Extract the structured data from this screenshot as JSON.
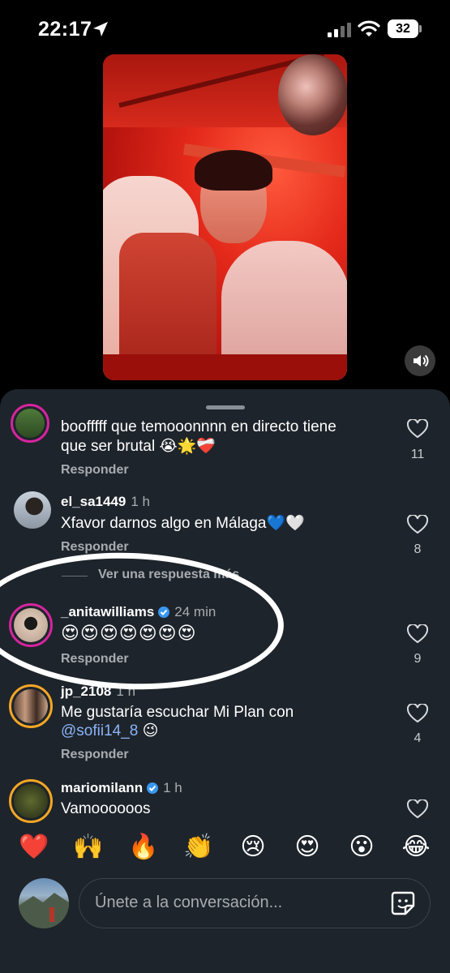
{
  "status_bar": {
    "time": "22:17",
    "battery": "32"
  },
  "comments": [
    {
      "user": "",
      "time": "",
      "text": "boofffff que temooonnnn en directo tiene",
      "text2": "que ser brutal 😭🌟❤️‍🩹",
      "reply": "Responder",
      "likes": "11"
    },
    {
      "user": "el_sa1449",
      "time": "1 h",
      "text": "Xfavor darnos algo en Málaga💙🤍",
      "reply": "Responder",
      "likes": "8",
      "more": "Ver una respuesta más"
    },
    {
      "user": "_anitawilliams",
      "time": "24 min",
      "verified": true,
      "text": "😍😍😍😍😍😍😍",
      "reply": "Responder",
      "likes": "9"
    },
    {
      "user": "jp_2108",
      "time": "1 h",
      "text": "Me gustaría escuchar Mi Plan con",
      "mention": "@sofii14_8",
      "mention_tail": " 😉",
      "reply": "Responder",
      "likes": "4"
    },
    {
      "user": "mariomilann",
      "time": "1 h",
      "verified": true,
      "text": "Vamoooooos"
    }
  ],
  "quick_reactions": [
    "❤️",
    "🙌",
    "🔥",
    "👏",
    "😢",
    "😍",
    "😮",
    "😂"
  ],
  "composer": {
    "placeholder": "Únete a la conversación..."
  },
  "colors": {
    "sheet_bg": "#1e242b",
    "verified": "#3897f0",
    "mention": "#8ab4f8",
    "story_ring": "#d6249f"
  }
}
